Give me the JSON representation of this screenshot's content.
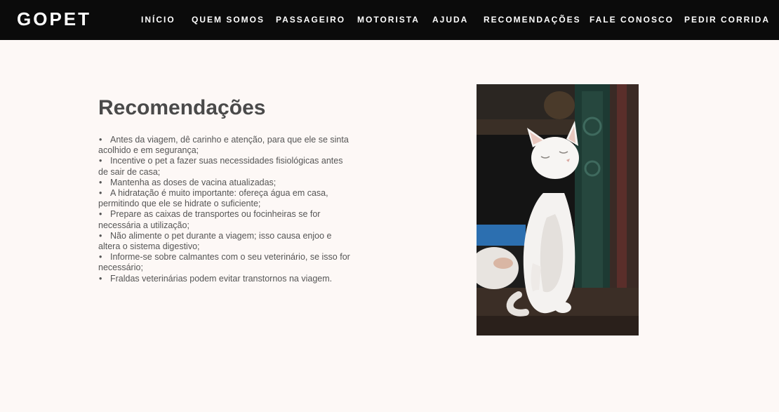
{
  "header": {
    "brand": "GOPET",
    "nav": [
      {
        "label": "INÍCIO"
      },
      {
        "label": "QUEM SOMOS"
      },
      {
        "label": "PASSAGEIRO"
      },
      {
        "label": "MOTORISTA"
      },
      {
        "label": "AJUDA"
      },
      {
        "label": "RECOMENDAÇÕES"
      },
      {
        "label": "FALE CONOSCO"
      },
      {
        "label": "PEDIR CORRIDA"
      }
    ]
  },
  "main": {
    "title": "Recomendações",
    "tips": [
      "Antes da viagem, dê carinho e atenção, para que ele se sinta acolhido e em segurança;",
      "Incentive o pet a fazer suas necessidades fisiológicas antes de sair de casa;",
      "Mantenha as doses de vacina atualizadas;",
      "A hidratação é muito importante: ofereça água em casa, permitindo que ele se hidrate o suficiente;",
      "Prepare as caixas de transportes ou focinheiras se for necessária a utilização;",
      "Não alimente o pet durante a viagem; isso causa enjoo e altera o sistema digestivo;",
      "Informe-se sobre calmantes com o seu veterinário, se isso for necessário;",
      "Fraldas veterinárias podem evitar transtornos na viagem."
    ],
    "photo_subject": "white-cat"
  },
  "colors": {
    "header_bg": "#0b0b0b",
    "page_bg": "#fdf8f6",
    "title": "#4a4a4a",
    "text": "#555555"
  }
}
